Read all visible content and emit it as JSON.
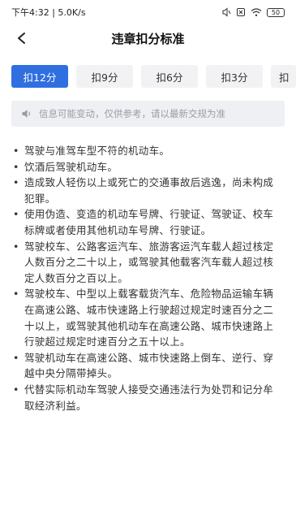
{
  "status": {
    "time_speed": "下午4:32 | 5.0K/s",
    "battery": "50"
  },
  "header": {
    "title": "违章扣分标准"
  },
  "tabs": [
    {
      "label": "扣12分",
      "active": true
    },
    {
      "label": "扣9分",
      "active": false
    },
    {
      "label": "扣6分",
      "active": false
    },
    {
      "label": "扣3分",
      "active": false
    },
    {
      "label": "扣",
      "active": false
    }
  ],
  "notice": {
    "text": "信息可能变动，仅供参考，请以最新交规为准"
  },
  "rules": [
    "驾驶与准驾车型不符的机动车。",
    "饮酒后驾驶机动车。",
    "造成致人轻伤以上或死亡的交通事故后逃逸，尚未构成犯罪。",
    "使用伪造、变造的机动车号牌、行驶证、驾驶证、校车标牌或者使用其他机动车号牌、行驶证。",
    "驾驶校车、公路客运汽车、旅游客运汽车载人超过核定人数百分之二十以上，或驾驶其他载客汽车载人超过核定人数百分之百以上。",
    "驾驶校车、中型以上载客载货汽车、危险物品运输车辆在高速公路、城市快速路上行驶超过规定时速百分之二十以上，或驾驶其他机动车在高速公路、城市快速路上行驶超过规定时速百分之五十以上。",
    "驾驶机动车在高速公路、城市快速路上倒车、逆行、穿越中央分隔带掉头。",
    "代替实际机动车驾驶人接受交通违法行为处罚和记分牟取经济利益。"
  ],
  "colors": {
    "accent": "#2f6fe0",
    "tab_bg": "#f2f2f4",
    "notice_bg": "#eff0f4"
  }
}
